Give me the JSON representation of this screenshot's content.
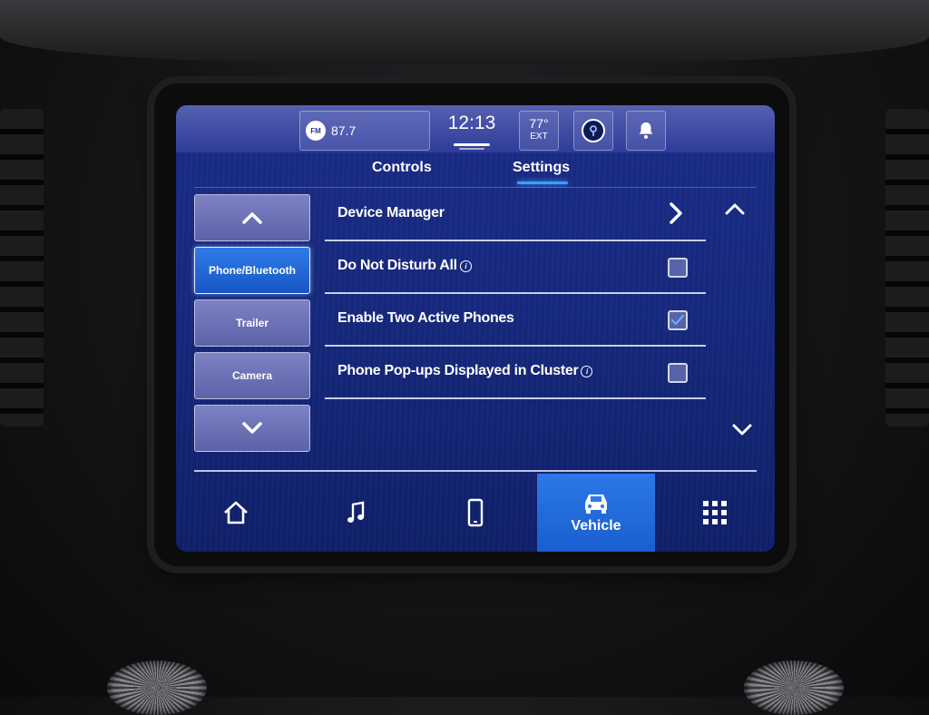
{
  "status": {
    "radio_band": "FM",
    "radio_freq": "87.7",
    "clock": "12:13",
    "temp_value": "77°",
    "temp_unit": "EXT"
  },
  "tabs": [
    {
      "label": "Controls",
      "active": false
    },
    {
      "label": "Settings",
      "active": true
    }
  ],
  "sidebar": {
    "items": [
      {
        "label": "Phone/Bluetooth",
        "active": true
      },
      {
        "label": "Trailer",
        "active": false
      },
      {
        "label": "Camera",
        "active": false
      }
    ]
  },
  "settings": {
    "rows": [
      {
        "label": "Device Manager",
        "type": "link"
      },
      {
        "label": "Do Not Disturb All",
        "type": "checkbox",
        "checked": false,
        "info": true
      },
      {
        "label": "Enable Two Active Phones",
        "type": "checkbox",
        "checked": true,
        "info": false
      },
      {
        "label": "Phone Pop-ups Displayed in Cluster",
        "type": "checkbox",
        "checked": false,
        "info": true
      }
    ],
    "info_glyph": "i"
  },
  "bottom_nav": {
    "items": [
      {
        "icon": "home-icon",
        "label": ""
      },
      {
        "icon": "music-note-icon",
        "label": ""
      },
      {
        "icon": "phone-icon",
        "label": ""
      },
      {
        "icon": "car-icon",
        "label": "Vehicle",
        "active": true
      },
      {
        "icon": "apps-grid-icon",
        "label": ""
      }
    ]
  },
  "colors": {
    "accent_active": "#1f67da",
    "screen_bg": "#16287c",
    "tab_underline": "#3aa0ff"
  }
}
